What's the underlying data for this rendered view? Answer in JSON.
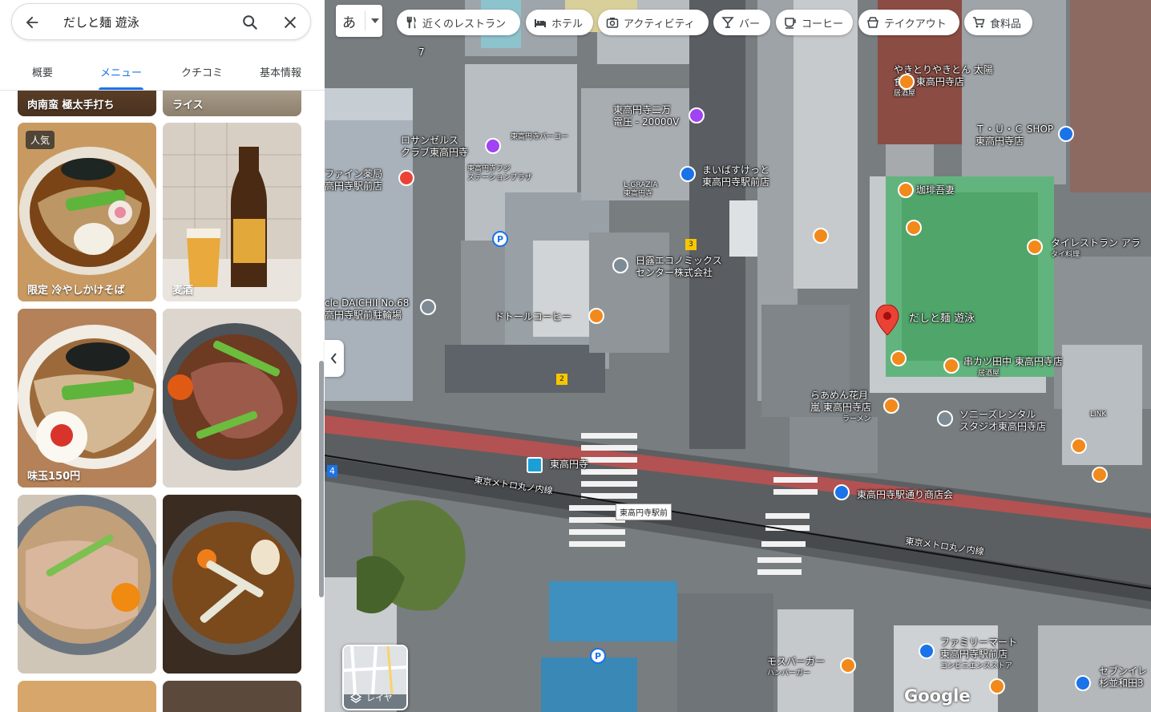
{
  "search": {
    "value": "だしと麺 遊泳"
  },
  "tabs": [
    {
      "label": "概要",
      "active": false
    },
    {
      "label": "メニュー",
      "active": true
    },
    {
      "label": "クチコミ",
      "active": false
    },
    {
      "label": "基本情報",
      "active": false
    }
  ],
  "photos": {
    "row0": [
      {
        "caption": "肉南蛮 極太手打ち"
      },
      {
        "caption": "ライス"
      }
    ],
    "row1": [
      {
        "caption": "限定 冷やしかけそば",
        "badge": "人気"
      },
      {
        "caption": "麦酒"
      }
    ],
    "row2": [
      {
        "caption": "味玉150円"
      },
      {
        "caption": ""
      }
    ]
  },
  "language_button": {
    "label": "あ"
  },
  "chips": [
    {
      "label": "近くのレストラン",
      "icon": "fork-knife-icon"
    },
    {
      "label": "ホテル",
      "icon": "bed-icon"
    },
    {
      "label": "アクティビティ",
      "icon": "camera-icon"
    },
    {
      "label": "バー",
      "icon": "cocktail-icon"
    },
    {
      "label": "コーヒー",
      "icon": "coffee-icon"
    },
    {
      "label": "テイクアウト",
      "icon": "takeout-icon"
    },
    {
      "label": "食料品",
      "icon": "cart-icon"
    }
  ],
  "map": {
    "selected_place": "だしと麺 遊泳",
    "labels": {
      "yakitori": [
        "やきとりやきとん 太陽",
        "食堂 東高円寺店"
      ],
      "yakitori_type": "居酒屋",
      "tuc": [
        "Ｔ・Ｕ・Ｃ SHOP",
        "東高円寺店"
      ],
      "nimanden": [
        "東高円寺二万",
        "電圧 - 20000V"
      ],
      "losangeles": [
        "ロサンゼルス",
        "クラブ東高円寺"
      ],
      "hashitaka": "東高円寺バーコー",
      "station_plaza": [
        "東高円寺フジ",
        "ステーションプラザ"
      ],
      "pharmacy": [
        "ファイン薬局",
        "高円寺駅前店"
      ],
      "mybasket": [
        "まいばすけっと",
        "東高円寺駅前店"
      ],
      "lgrazia": [
        "L-GRAZIA",
        "東高円寺"
      ],
      "kohiten": "珈琲吾妻",
      "thai": [
        "タイレストラン アラ",
        "タイ料理"
      ],
      "nichiro": [
        "日露エコノミックス",
        "センター株式会社"
      ],
      "daichii": [
        "cle DAICHII No.68",
        "高円寺駅前駐輪場"
      ],
      "doutor": "ドトールコーヒー",
      "kushikatsu": [
        "串カツ田中 東高円寺店",
        "居酒屋"
      ],
      "hanatsuki": [
        "らあめん花月",
        "嵐 東高円寺店",
        "ラーメン"
      ],
      "sonyz": [
        "ソニーズレンタル",
        "スタジオ東高円寺店"
      ],
      "station": "東高円寺",
      "metro": "東京メトロ丸ノ内線",
      "metro2": "東京メトロ丸ノ内線",
      "shotengai": "東高円寺駅通り商店会",
      "ekimae": "東高円寺駅前",
      "familymart": [
        "ファミリーマート",
        "東高円寺駅前店",
        "コンビニエンスストア"
      ],
      "mos": [
        "モスバーガー",
        "ハンバーガー"
      ],
      "seven": [
        "セブンイレ",
        "杉並和田3"
      ],
      "link": "LINK",
      "num7": "7",
      "num4": "4",
      "sign3": "3",
      "sign2": "2"
    },
    "layers_label": "レイヤ",
    "attribution": "Google"
  },
  "colors": {
    "accent": "#1a73e8",
    "food_pin": "#f2891b",
    "shop_pin": "#1a73e8",
    "entertainment_pin": "#a142f4",
    "generic_pin": "#7d8b94",
    "selected_pin": "#ea4335"
  }
}
